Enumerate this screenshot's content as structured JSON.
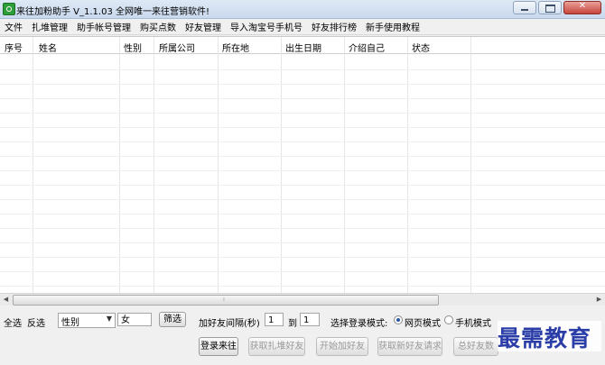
{
  "window": {
    "title": "来往加粉助手 V_1.1.03  全网唯一来往营销软件!",
    "close_symbol": "✕"
  },
  "menu": [
    {
      "label": "文件"
    },
    {
      "label": "扎堆管理"
    },
    {
      "label": "助手帐号管理"
    },
    {
      "label": "购买点数"
    },
    {
      "label": "好友管理"
    },
    {
      "label": "导入淘宝号手机号"
    },
    {
      "label": "好友排行榜"
    },
    {
      "label": "新手使用教程"
    }
  ],
  "table": {
    "columns": [
      "序号",
      "姓名",
      "性别",
      "所属公司",
      "所在地",
      "出生日期",
      "介绍自己",
      "状态"
    ],
    "rows": []
  },
  "filter": {
    "select_all": "全选",
    "invert_select": "反选",
    "field_select_value": "性别",
    "field_value": "女",
    "filter_button": "筛选"
  },
  "interval": {
    "label": "加好友间隔(秒)",
    "from": "1",
    "to_label": "到",
    "to": "1"
  },
  "login_mode": {
    "label": "选择登录模式:",
    "options": [
      {
        "label": "网页模式",
        "selected": true
      },
      {
        "label": "手机模式",
        "selected": false
      }
    ]
  },
  "actions": {
    "login": "登录来往",
    "fetch_group_friends": "获取扎堆好友",
    "start_add_friends": "开始加好友",
    "fetch_new_requests": "获取新好友请求",
    "total_friends": "总好友数"
  },
  "watermark": "最需教育"
}
